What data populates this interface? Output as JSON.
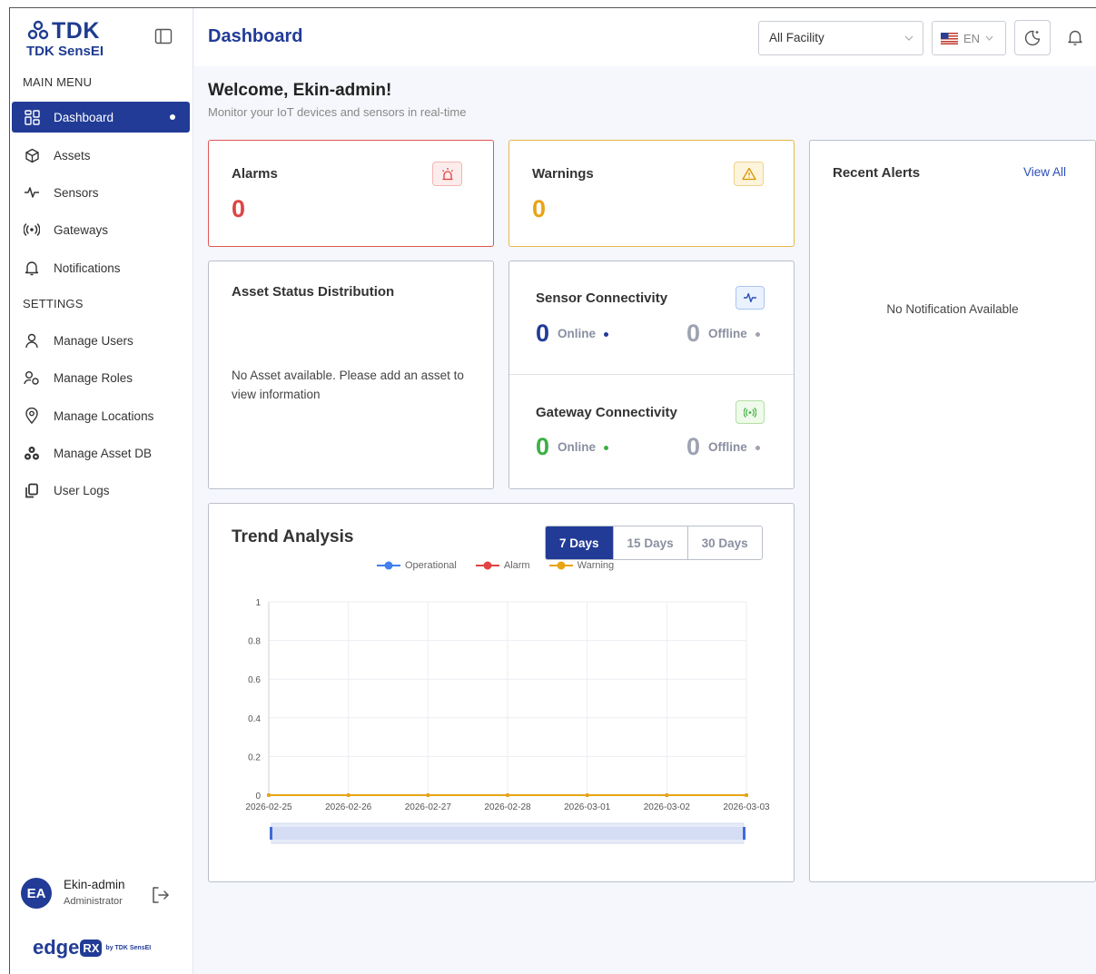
{
  "brand": {
    "logo_text": "TDK",
    "product_name": "TDK SensEI"
  },
  "sidebar": {
    "main_menu_label": "MAIN MENU",
    "items": [
      {
        "label": "Dashboard",
        "icon": "dashboard-grid-icon",
        "active": true
      },
      {
        "label": "Assets",
        "icon": "box-icon"
      },
      {
        "label": "Sensors",
        "icon": "pulse-icon"
      },
      {
        "label": "Gateways",
        "icon": "broadcast-icon"
      },
      {
        "label": "Notifications",
        "icon": "bell-icon"
      }
    ],
    "settings_label": "SETTINGS",
    "settings_items": [
      {
        "label": "Manage Users",
        "icon": "user-icon"
      },
      {
        "label": "Manage Roles",
        "icon": "users-key-icon"
      },
      {
        "label": "Manage Locations",
        "icon": "map-pin-icon"
      },
      {
        "label": "Manage Asset DB",
        "icon": "boxes-icon"
      },
      {
        "label": "User Logs",
        "icon": "copy-icon"
      }
    ],
    "user": {
      "initials": "EA",
      "name": "Ekin-admin",
      "role": "Administrator"
    },
    "footer_brand": {
      "edge": "edge",
      "rx": "RX",
      "by": "by TDK SensEI"
    }
  },
  "header": {
    "title": "Dashboard",
    "facility_select": "All Facility",
    "language": "EN"
  },
  "welcome": {
    "title": "Welcome, Ekin-admin!",
    "subtitle": "Monitor your IoT devices and sensors in real-time"
  },
  "alarms": {
    "title": "Alarms",
    "count": "0"
  },
  "warnings": {
    "title": "Warnings",
    "count": "0"
  },
  "asset_status": {
    "title": "Asset Status Distribution",
    "empty_message": "No Asset available. Please add an asset to view information"
  },
  "sensor_connectivity": {
    "title": "Sensor Connectivity",
    "online": "0",
    "online_label": "Online",
    "offline": "0",
    "offline_label": "Offline"
  },
  "gateway_connectivity": {
    "title": "Gateway Connectivity",
    "online": "0",
    "online_label": "Online",
    "offline": "0",
    "offline_label": "Offline"
  },
  "recent_alerts": {
    "title": "Recent Alerts",
    "view_all": "View All",
    "empty_message": "No Notification Available"
  },
  "trend": {
    "title": "Trend Analysis",
    "tabs": [
      {
        "label": "7 Days",
        "active": true
      },
      {
        "label": "15 Days"
      },
      {
        "label": "30 Days"
      }
    ]
  },
  "colors": {
    "primary": "#213b96",
    "alarm": "#e04444",
    "warning": "#e8a415",
    "online_sensor": "#213b96",
    "online_gateway": "#3cb043",
    "operational": "#3f7ff0"
  },
  "chart_data": {
    "type": "line",
    "x": [
      "2026-02-25",
      "2026-02-26",
      "2026-02-27",
      "2026-02-28",
      "2026-03-01",
      "2026-03-02",
      "2026-03-03"
    ],
    "series": [
      {
        "name": "Operational",
        "color": "#3f7ff0",
        "values": [
          0,
          0,
          0,
          0,
          0,
          0,
          0
        ]
      },
      {
        "name": "Alarm",
        "color": "#e04444",
        "values": [
          0,
          0,
          0,
          0,
          0,
          0,
          0
        ]
      },
      {
        "name": "Warning",
        "color": "#e8a415",
        "values": [
          0,
          0,
          0,
          0,
          0,
          0,
          0
        ]
      }
    ],
    "yticks": [
      "0",
      "0.2",
      "0.4",
      "0.6",
      "0.8",
      "1"
    ],
    "ylim": [
      0,
      1
    ],
    "grid": true,
    "legend_placement": "top-center",
    "zoom_slider": true
  }
}
